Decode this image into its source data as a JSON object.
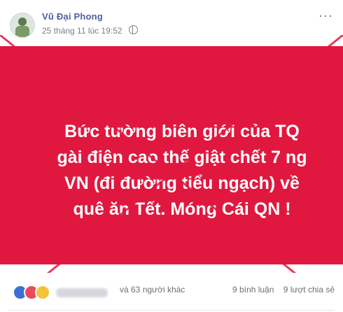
{
  "post": {
    "author": "Vũ Đại Phong",
    "timestamp": "25 tháng 11 lúc 19:52",
    "privacy_icon": "globe-icon",
    "more_icon": "ellipsis-icon",
    "more_label": "···"
  },
  "banner": {
    "background_color": "#e0183f",
    "x_mark_color": "#e0183f",
    "lines": [
      "Bức tường biên giới của TQ",
      "gài điện cao thế giật chết 7 ng",
      "VN (đi đường tiểu ngạch) về",
      "quê ăn Tết. Móng Cái QN !"
    ]
  },
  "footer": {
    "reactions_text": "và 63 người khác",
    "comments": "9 bình luận",
    "shares": "9 lượt chia sẻ"
  }
}
